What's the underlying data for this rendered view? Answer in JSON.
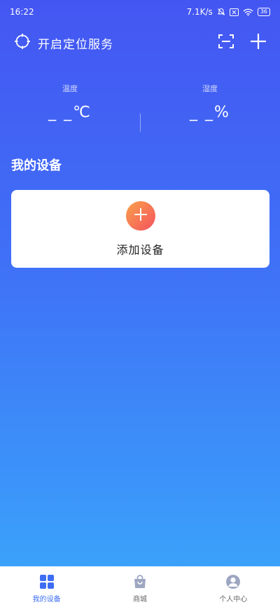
{
  "status_bar": {
    "time": "16:22",
    "network_speed": "7.1K/s",
    "battery": "36"
  },
  "header": {
    "location_label": "开启定位服务"
  },
  "readings": {
    "temperature": {
      "label": "温度",
      "value": "_ _℃"
    },
    "humidity": {
      "label": "湿度",
      "value": "_ _%"
    }
  },
  "devices": {
    "section_title": "我的设备",
    "add_label": "添加设备"
  },
  "bottom_nav": {
    "items": [
      {
        "label": "我的设备",
        "icon": "grid-icon",
        "active": true
      },
      {
        "label": "商城",
        "icon": "shopping-bag-icon",
        "active": false
      },
      {
        "label": "个人中心",
        "icon": "person-icon",
        "active": false
      }
    ]
  },
  "colors": {
    "gradient_top": "#4456f2",
    "gradient_bottom": "#3aa8fb",
    "accent": "#3e6df3",
    "add_gradient_start": "#f9a14a",
    "add_gradient_end": "#f4525e"
  }
}
